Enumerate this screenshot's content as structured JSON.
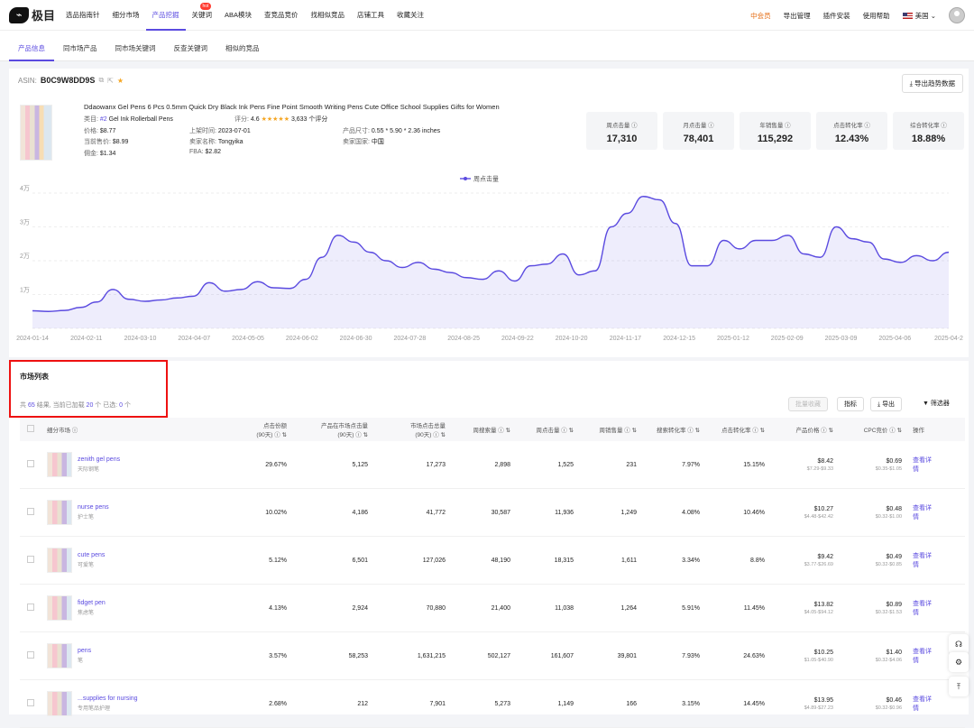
{
  "app": {
    "logo_text": "极目"
  },
  "nav": {
    "items": [
      "选品指南针",
      "细分市场",
      "产品挖掘",
      "关键词",
      "ABA模块",
      "查竞品竞价",
      "找相似竞品",
      "店铺工具",
      "收藏关注"
    ],
    "active": "产品挖掘",
    "hot_badge": "hot",
    "right": {
      "vip": "中会员",
      "export": "导出管理",
      "plugin": "插件安装",
      "help": "使用帮助",
      "region": "美国"
    }
  },
  "subtabs": [
    "产品信息",
    "同市场产品",
    "同市场关键词",
    "反查关键词",
    "相似的竞品"
  ],
  "product": {
    "asin_label": "ASIN:",
    "asin": "B0C9W8DD9S",
    "export_button": "导出趋势数据",
    "title": "Ddaowanx Gel Pens 6 Pcs 0.5mm Quick Dry Black Ink Pens Fine Point Smooth Writing Pens Cute Office School Supplies Gifts for Women",
    "category_label": "类目:",
    "category_rank": "#2",
    "category": "Gel Ink Rollerball Pens",
    "rating_label": "评分:",
    "rating": "4.6",
    "rating_count": "3,633 个评分",
    "price_label": "价格:",
    "price": "$8.77",
    "current_price_label": "当前售价:",
    "current_price": "$8.99",
    "commission_label": "佣金:",
    "commission": "$1.34",
    "launch_label": "上架时间:",
    "launch": "2023-07-01",
    "seller_label": "卖家名称:",
    "seller": "Tongyika",
    "fba_label": "FBA:",
    "fba": "$2.82",
    "size_label": "产品尺寸:",
    "size": "0.55 * 5.90 * 2.36 inches",
    "country_label": "卖家国家:",
    "country": "中国"
  },
  "metrics": [
    {
      "label": "周点击量",
      "value": "17,310"
    },
    {
      "label": "月点击量",
      "value": "78,401"
    },
    {
      "label": "年销售量",
      "value": "115,292"
    },
    {
      "label": "点击转化率",
      "value": "12.43%"
    },
    {
      "label": "综合转化率",
      "value": "18.88%"
    }
  ],
  "chart_data": {
    "type": "area",
    "series": [
      {
        "name": "周点击量",
        "color": "#5b4be0"
      }
    ],
    "yticks": [
      "0",
      "1万",
      "2万",
      "3万",
      "4万"
    ],
    "ylim": [
      0,
      40000
    ],
    "xticks": [
      "2024-01-14",
      "2024-02-11",
      "2024-03-10",
      "2024-04-07",
      "2024-05-05",
      "2024-06-02",
      "2024-06-30",
      "2024-07-28",
      "2024-08-25",
      "2024-09-22",
      "2024-10-20",
      "2024-11-17",
      "2024-12-15",
      "2025-01-12",
      "2025-02-09",
      "2025-03-09",
      "2025-04-06",
      "2025-04-2"
    ],
    "values": [
      5200,
      5000,
      5300,
      6200,
      7800,
      11500,
      8600,
      8000,
      8400,
      9000,
      9500,
      13500,
      11000,
      11500,
      13800,
      12000,
      11800,
      14500,
      21000,
      27500,
      25500,
      22500,
      20000,
      18000,
      19500,
      17500,
      16500,
      15000,
      14500,
      17000,
      14000,
      18500,
      19000,
      22000,
      15800,
      17000,
      30000,
      34000,
      39000,
      38000,
      31000,
      18500,
      18500,
      26000,
      23500,
      26000,
      26000,
      27500,
      22000,
      21000,
      30000,
      26500,
      25500,
      20500,
      19500,
      21500,
      20000,
      22500
    ]
  },
  "market": {
    "title": "市场列表",
    "count_prefix": "共",
    "total": "65",
    "count_mid": "结果, 当前已加载",
    "loaded": "20",
    "count_mid2": "个  已选:",
    "selected": "0",
    "count_suffix": "个",
    "buttons": {
      "batch": "批量收藏",
      "metrics": "指标",
      "export": "导出",
      "filter": "筛选器"
    },
    "headers": [
      "细分市场",
      "点击份额\n(90天)",
      "产品在市场点击量\n(90天)",
      "市场点击总量\n(90天)",
      "周搜索量",
      "周点击量",
      "周销售量",
      "搜索转化率",
      "点击转化率",
      "产品价格",
      "CPC竞价",
      "操作"
    ],
    "rows": [
      {
        "en": "zenith gel pens",
        "cn": "天际钢笔",
        "share": "29.67%",
        "prod_clicks": "5,125",
        "market_clicks": "17,273",
        "w_search": "2,898",
        "w_clicks": "1,525",
        "w_sales": "231",
        "search_cv": "7.97%",
        "click_cv": "15.15%",
        "price": "$8.42",
        "price_range": "$7.29-$9.33",
        "cpc": "$0.69",
        "cpc_range": "$0.35-$1.05",
        "action": "查看详情"
      },
      {
        "en": "nurse pens",
        "cn": "护士笔",
        "share": "10.02%",
        "prod_clicks": "4,186",
        "market_clicks": "41,772",
        "w_search": "30,587",
        "w_clicks": "11,936",
        "w_sales": "1,249",
        "search_cv": "4.08%",
        "click_cv": "10.46%",
        "price": "$10.27",
        "price_range": "$4.48-$42.42",
        "cpc": "$0.48",
        "cpc_range": "$0.32-$1.00",
        "action": "查看详情"
      },
      {
        "en": "cute pens",
        "cn": "可爱笔",
        "share": "5.12%",
        "prod_clicks": "6,501",
        "market_clicks": "127,026",
        "w_search": "48,190",
        "w_clicks": "18,315",
        "w_sales": "1,611",
        "search_cv": "3.34%",
        "click_cv": "8.8%",
        "price": "$9.42",
        "price_range": "$3.77-$26.69",
        "cpc": "$0.49",
        "cpc_range": "$0.32-$0.85",
        "action": "查看详情"
      },
      {
        "en": "fidget pen",
        "cn": "焦虑笔",
        "share": "4.13%",
        "prod_clicks": "2,924",
        "market_clicks": "70,880",
        "w_search": "21,400",
        "w_clicks": "11,038",
        "w_sales": "1,264",
        "search_cv": "5.91%",
        "click_cv": "11.45%",
        "price": "$13.82",
        "price_range": "$4.05-$94.12",
        "cpc": "$0.89",
        "cpc_range": "$0.32-$1.53",
        "action": "查看详情"
      },
      {
        "en": "pens",
        "cn": "笔",
        "share": "3.57%",
        "prod_clicks": "58,253",
        "market_clicks": "1,631,215",
        "w_search": "502,127",
        "w_clicks": "161,607",
        "w_sales": "39,801",
        "search_cv": "7.93%",
        "click_cv": "24.63%",
        "price": "$10.25",
        "price_range": "$1.05-$40.90",
        "cpc": "$1.40",
        "cpc_range": "$0.32-$4.06",
        "action": "查看详情"
      },
      {
        "en": "...supplies for nursing",
        "cn": "专用笔品护理",
        "share": "2.68%",
        "prod_clicks": "212",
        "market_clicks": "7,901",
        "w_search": "5,273",
        "w_clicks": "1,149",
        "w_sales": "166",
        "search_cv": "3.15%",
        "click_cv": "14.45%",
        "price": "$13.95",
        "price_range": "$4.89-$27.23",
        "cpc": "$0.46",
        "cpc_range": "$0.32-$0.96",
        "action": "查看详情"
      }
    ]
  }
}
